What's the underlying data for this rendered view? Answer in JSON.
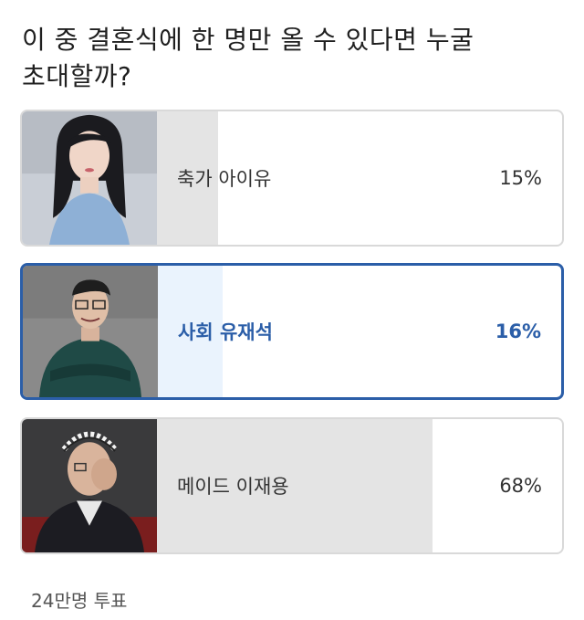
{
  "poll": {
    "question_line1": "이 중 결혼식에 한 명만 올 수 있다면 누굴",
    "question_line2": "초대할까?",
    "options": [
      {
        "label": "축가 아이유",
        "percent_text": "15%",
        "percent": 15,
        "selected": false
      },
      {
        "label": "사회 유재석",
        "percent_text": "16%",
        "percent": 16,
        "selected": true
      },
      {
        "label": "메이드 이재용",
        "percent_text": "68%",
        "percent": 68,
        "selected": false
      }
    ],
    "vote_count": "24만명 투표"
  },
  "colors": {
    "selected_border": "#2b5ea8",
    "selected_fill": "#eaf3fd",
    "bar_fill": "#e4e4e4",
    "border": "#d9d9d9"
  }
}
